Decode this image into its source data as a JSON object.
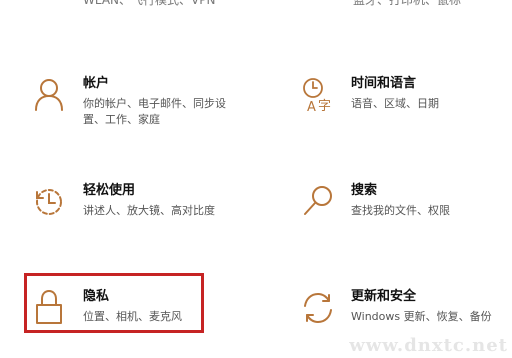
{
  "partial_top": {
    "left_text": "WLAN、飞行模式、VPN",
    "right_text": "蓝牙、打印机、鼠标"
  },
  "tiles": [
    {
      "title": "帐户",
      "desc": [
        "你的帐户、电子邮件、同步设",
        "置、工作、家庭"
      ],
      "icon": "person-icon"
    },
    {
      "title": "时间和语言",
      "desc": [
        "语音、区域、日期"
      ],
      "icon": "time-language-icon"
    },
    {
      "title": "轻松使用",
      "desc": [
        "讲述人、放大镜、高对比度"
      ],
      "icon": "ease-of-access-icon"
    },
    {
      "title": "搜索",
      "desc": [
        "查找我的文件、权限"
      ],
      "icon": "search-icon"
    },
    {
      "title": "隐私",
      "desc": [
        "位置、相机、麦克风"
      ],
      "icon": "lock-icon"
    },
    {
      "title": "更新和安全",
      "desc": [
        "Windows 更新、恢复、备份"
      ],
      "icon": "update-sync-icon"
    }
  ],
  "colors": {
    "accent": "#b8763a",
    "highlight_border": "#c62323"
  },
  "watermark": "www.dnxtc.net"
}
